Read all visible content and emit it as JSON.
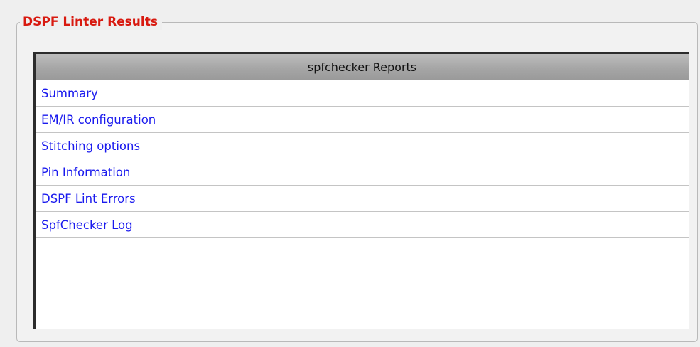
{
  "groupbox": {
    "title": "DSPF Linter Results"
  },
  "report_table": {
    "header": "spfchecker Reports",
    "items": [
      {
        "label": "Summary"
      },
      {
        "label": "EM/IR configuration"
      },
      {
        "label": "Stitching options"
      },
      {
        "label": "Pin Information"
      },
      {
        "label": "DSPF Lint Errors"
      },
      {
        "label": "SpfChecker Log"
      }
    ]
  },
  "colors": {
    "title": "#d8190f",
    "link": "#1a1aee",
    "header_bg": "#a6a6a6",
    "window_bg": "#efefef"
  }
}
